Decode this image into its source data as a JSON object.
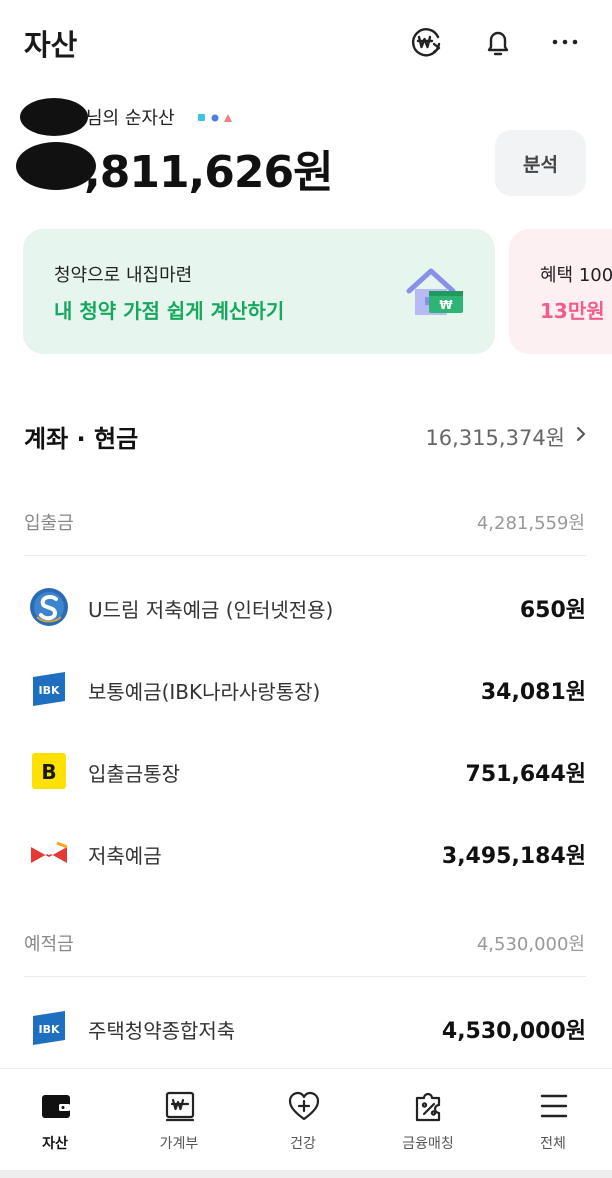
{
  "header": {
    "title": "자산",
    "icons": [
      "won-exchange-icon",
      "bell-icon",
      "more-icon"
    ]
  },
  "summary": {
    "owner_label": "님의 순자산",
    "net_assets": ",811,626원",
    "analyze_label": "분석"
  },
  "banners": [
    {
      "subtitle": "청약으로 내집마련",
      "title": "내 청약 가점 쉽게 계산하기",
      "icon": "house-won-icon",
      "color": "#17a860"
    },
    {
      "subtitle": "혜택 100",
      "title": "13만원",
      "color": "#f25d8a"
    }
  ],
  "accounts_section": {
    "title": "계좌 · 현금",
    "total": "16,315,374원",
    "groups": [
      {
        "label": "입출금",
        "total": "4,281,559원",
        "items": [
          {
            "name": "U드림 저축예금 (인터넷전용)",
            "amount": "650원",
            "logo": "shinhan-logo-icon"
          },
          {
            "name": "보통예금(IBK나라사랑통장)",
            "amount": "34,081원",
            "logo": "ibk-logo-icon"
          },
          {
            "name": "입출금통장",
            "amount": "751,644원",
            "logo": "kakaobank-logo-icon"
          },
          {
            "name": "저축예금",
            "amount": "3,495,184원",
            "logo": "postbank-logo-icon"
          }
        ]
      },
      {
        "label": "예적금",
        "total": "4,530,000원",
        "items": [
          {
            "name": "주택청약종합저축",
            "amount": "4,530,000원",
            "logo": "ibk-logo-icon"
          }
        ]
      }
    ]
  },
  "tabbar": {
    "tabs": [
      {
        "label": "자산",
        "icon": "wallet-icon",
        "active": true
      },
      {
        "label": "가계부",
        "icon": "ledger-icon",
        "active": false
      },
      {
        "label": "건강",
        "icon": "heart-plus-icon",
        "active": false
      },
      {
        "label": "금융매칭",
        "icon": "puzzle-percent-icon",
        "active": false
      },
      {
        "label": "전체",
        "icon": "menu-icon",
        "active": false
      }
    ]
  },
  "colors": {
    "accent_green": "#17a860",
    "accent_pink": "#f25d8a",
    "banner_green_bg": "#e6f6ef",
    "banner_pink_bg": "#fdf0f3"
  }
}
